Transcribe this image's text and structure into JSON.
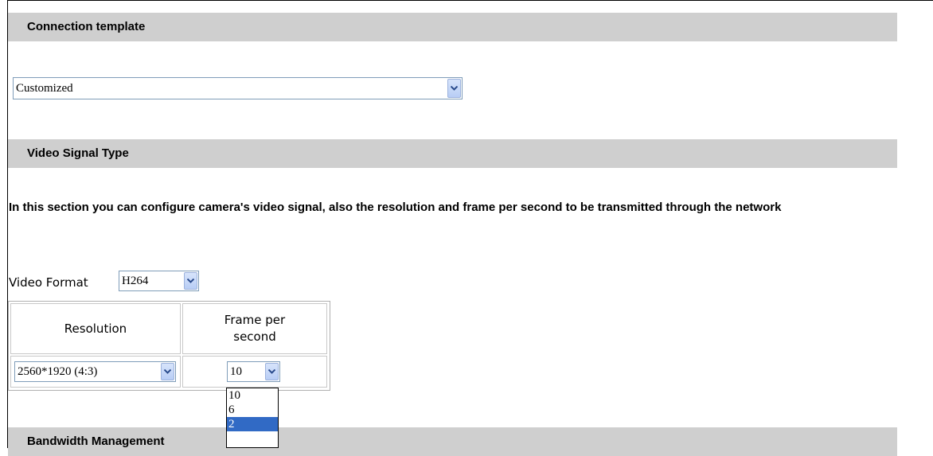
{
  "sections": {
    "connection_template": "Connection template",
    "video_signal_type": "Video Signal Type",
    "bandwidth_management": "Bandwidth Management"
  },
  "connection_template_select": {
    "value": "Customized"
  },
  "description": "In this section you can configure camera's video signal, also the resolution and frame per second to be transmitted through the network",
  "video_format": {
    "label": "Video Format",
    "value": "H264"
  },
  "table": {
    "col_resolution": "Resolution",
    "col_fps": "Frame per second",
    "resolution_value": "2560*1920 (4:3)",
    "fps_value": "10"
  },
  "fps_options": [
    "10",
    "6",
    "2"
  ],
  "fps_highlighted_index": 2,
  "colors": {
    "section_bar": "#cfcfcf",
    "highlight": "#316ac5",
    "dropdown_button": "#c6d6f6"
  },
  "icons": {
    "dropdown": "chevron-down-icon"
  }
}
